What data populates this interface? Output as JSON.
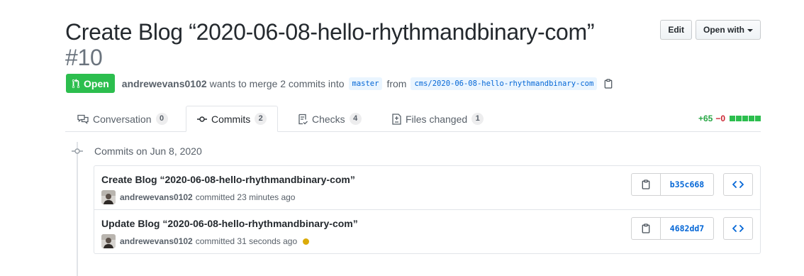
{
  "header": {
    "title": "Create Blog “2020-06-08-hello-rhythmandbinary-com”",
    "number": "#10",
    "edit_label": "Edit",
    "open_with_label": "Open with"
  },
  "meta": {
    "state": "Open",
    "author": "andrewevans0102",
    "merge_text": "wants to merge 2 commits into",
    "base_branch": "master",
    "from_text": "from",
    "head_branch": "cms/2020-06-08-hello-rhythmandbinary-com"
  },
  "tabs": [
    {
      "label": "Conversation",
      "count": "0",
      "icon": "comment-discussion-icon"
    },
    {
      "label": "Commits",
      "count": "2",
      "icon": "git-commit-icon"
    },
    {
      "label": "Checks",
      "count": "4",
      "icon": "checklist-icon"
    },
    {
      "label": "Files changed",
      "count": "1",
      "icon": "file-diff-icon"
    }
  ],
  "diffstat": {
    "additions": "+65",
    "deletions": "−0",
    "blocks": 5
  },
  "timeline": {
    "heading": "Commits on Jun 8, 2020",
    "commits": [
      {
        "title": "Create Blog “2020-06-08-hello-rhythmandbinary-com”",
        "author": "andrewevans0102",
        "action": "committed 23 minutes ago",
        "sha": "b35c668",
        "status": ""
      },
      {
        "title": "Update Blog “2020-06-08-hello-rhythmandbinary-com”",
        "author": "andrewevans0102",
        "action": "committed 31 seconds ago",
        "sha": "4682dd7",
        "status": "pending"
      }
    ]
  },
  "colors": {
    "open_green": "#2cbe4e",
    "link_blue": "#0366d6",
    "addition": "#28a745",
    "deletion": "#cb2431",
    "pending": "#dbab09"
  }
}
